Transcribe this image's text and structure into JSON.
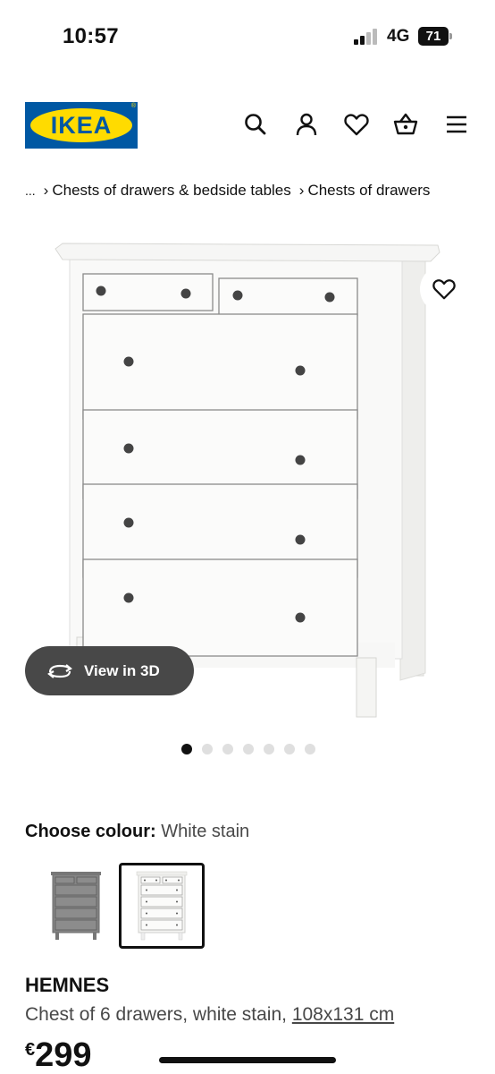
{
  "status_bar": {
    "time": "10:57",
    "network": "4G",
    "battery": "71"
  },
  "header": {
    "logo_text": "IKEA",
    "logo_registered": "®",
    "icons": [
      "search-icon",
      "account-icon",
      "favourites-icon",
      "basket-icon",
      "menu-icon"
    ]
  },
  "breadcrumb": {
    "ellipsis": "...",
    "items": [
      "Chests of drawers & bedside tables",
      "Chests of drawers"
    ]
  },
  "gallery": {
    "view_3d_label": "View in 3D",
    "dot_count": 7,
    "active_dot": 1
  },
  "colour": {
    "label": "Choose colour:",
    "value": "White stain",
    "options": [
      {
        "name": "grey",
        "color": "#8a8a8a",
        "selected": false
      },
      {
        "name": "white stain",
        "color": "#f4f4f2",
        "selected": true
      }
    ]
  },
  "product": {
    "name": "HEMNES",
    "description": "Chest of 6 drawers, white stain,",
    "dimensions": "108x131 cm",
    "currency": "€",
    "price": "299"
  },
  "colors": {
    "ikea_blue": "#0058a3",
    "ikea_yellow": "#ffdb00",
    "button_dark": "#484848"
  }
}
